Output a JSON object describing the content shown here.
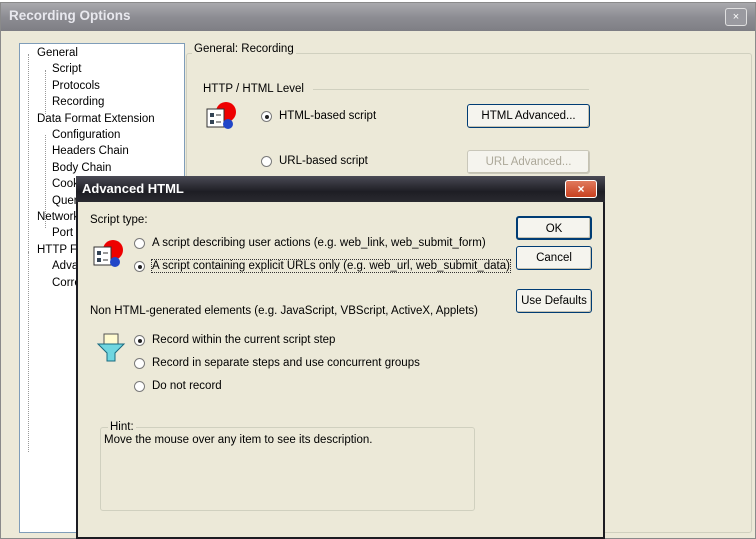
{
  "window": {
    "title": "Recording Options",
    "close": "×"
  },
  "tree": [
    {
      "label": "General",
      "level": 0
    },
    {
      "label": "Script",
      "level": 1
    },
    {
      "label": "Protocols",
      "level": 1
    },
    {
      "label": "Recording",
      "level": 1,
      "selected": true
    },
    {
      "label": "Data Format Extension",
      "level": 0
    },
    {
      "label": "Configuration",
      "level": 1
    },
    {
      "label": "Headers Chain",
      "level": 1
    },
    {
      "label": "Body Chain",
      "level": 1
    },
    {
      "label": "Cook",
      "level": 1
    },
    {
      "label": "Quer",
      "level": 1
    },
    {
      "label": "Network",
      "level": 0
    },
    {
      "label": "Port",
      "level": 1
    },
    {
      "label": "HTTP F",
      "level": 0
    },
    {
      "label": "Adva",
      "level": 1
    },
    {
      "label": "Corre",
      "level": 1
    }
  ],
  "main": {
    "group_title": "General: Recording",
    "section": "HTTP / HTML Level",
    "html_radio": "HTML-based script",
    "url_radio": "URL-based script",
    "selected": "html",
    "html_advanced": "HTML Advanced...",
    "url_advanced": "URL Advanced..."
  },
  "dialog": {
    "title": "Advanced HTML",
    "close": "×",
    "script_type_label": "Script type:",
    "script_options": [
      "A script describing user actions (e.g. web_link, web_submit_form)",
      "A script containing explicit URLs only (e.g. web_url, web_submit_data)"
    ],
    "script_selected": 1,
    "non_html_label": "Non HTML-generated elements (e.g. JavaScript, VBScript, ActiveX, Applets)",
    "non_html_options": [
      "Record within the current script step",
      "Record in separate steps and use concurrent groups",
      "Do not record"
    ],
    "non_html_selected": 0,
    "ok": "OK",
    "cancel": "Cancel",
    "use_defaults": "Use Defaults",
    "hint_label": "Hint:",
    "hint_text": "Move the mouse over any item to see its description."
  }
}
